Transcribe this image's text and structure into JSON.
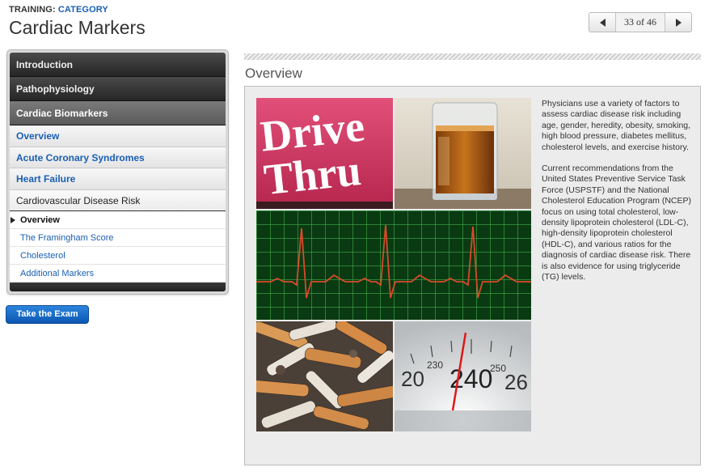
{
  "header": {
    "crumb_prefix": "TRAINING:",
    "crumb_link": "CATEGORY",
    "title": "Cardiac Markers",
    "pager": {
      "count": "33 of 46",
      "prev_icon": "triangle-left-icon",
      "next_icon": "triangle-right-icon"
    }
  },
  "sidebar": {
    "sections": [
      {
        "label": "Introduction"
      },
      {
        "label": "Pathophysiology"
      },
      {
        "label": "Cardiac Biomarkers"
      }
    ],
    "subitems": [
      {
        "label": "Overview"
      },
      {
        "label": "Acute Coronary Syndromes"
      },
      {
        "label": "Heart Failure"
      },
      {
        "label": "Cardiovascular Disease Risk"
      }
    ],
    "leaves": [
      {
        "label": "Overview"
      },
      {
        "label": "The Framingham Score"
      },
      {
        "label": "Cholesterol"
      },
      {
        "label": "Additional Markers"
      }
    ],
    "exam_button": "Take the Exam"
  },
  "main": {
    "section_title": "Overview",
    "images": {
      "drive_thru_sign": "Drive\nThru",
      "drive_line1": "Drive",
      "drive_line2": "Thru",
      "scale_numbers": [
        "20",
        "230",
        "240",
        "250",
        "26"
      ]
    },
    "paragraphs": [
      "Physicians use a variety of factors to assess cardiac disease risk including age, gender, heredity, obesity, smoking, high blood pressure, diabetes mellitus, cholesterol levels, and exercise history.",
      "Current recommendations from the United States Preventive Service Task Force (USPSTF) and the National Cholesterol Education Program (NCEP) focus on using total cholesterol, low-density lipoprotein cholesterol (LDL-C), high-density lipoprotein cholesterol (HDL-C), and various ratios for the diagnosis of cardiac disease risk. There is also evidence for using triglyceride (TG) levels."
    ]
  },
  "colors": {
    "link_blue": "#1a5fb4",
    "nav_dark": "#262626",
    "exam_button": "#0b57b0"
  }
}
